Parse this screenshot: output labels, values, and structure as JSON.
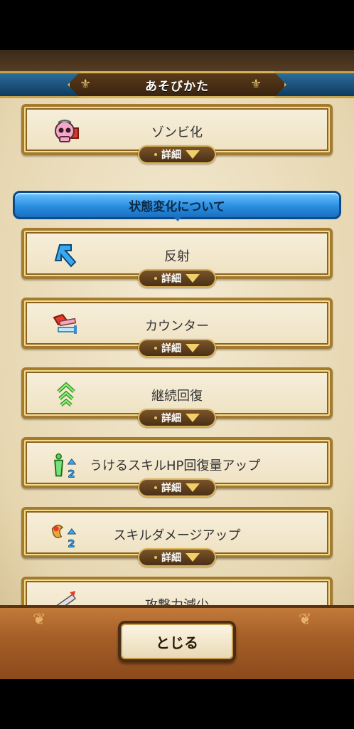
{
  "header": {
    "title": "あそびかた"
  },
  "cards_top": [
    {
      "label": "ゾンビ化",
      "icon": "zombie-skull-icon",
      "detail_label": "詳細"
    }
  ],
  "section": {
    "title": "状態変化について"
  },
  "cards": [
    {
      "label": "反射",
      "icon": "reflect-arrow-icon",
      "detail_label": "詳細"
    },
    {
      "label": "カウンター",
      "icon": "counter-sword-icon",
      "detail_label": "詳細"
    },
    {
      "label": "継続回復",
      "icon": "regen-chevron-icon",
      "detail_label": "詳細"
    },
    {
      "label": "うけるスキルHP回復量アップ",
      "icon": "skill-heal-up-icon",
      "detail_label": "詳細"
    },
    {
      "label": "スキルダメージアップ",
      "icon": "skill-damage-up-icon",
      "detail_label": "詳細"
    },
    {
      "label": "攻撃力減少",
      "icon": "attack-down-icon"
    }
  ],
  "footer": {
    "close_label": "とじる"
  },
  "colors": {
    "accent_blue": "#2a8ee0",
    "gold": "#d9b35a",
    "wood": "#a65f27"
  }
}
